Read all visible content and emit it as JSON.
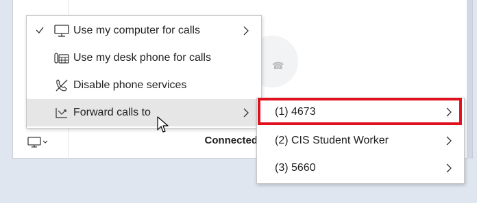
{
  "window": {
    "status_text": "Connected"
  },
  "menu": {
    "items": [
      {
        "label": "Use my computer for calls",
        "icon": "monitor-icon",
        "checked": true,
        "has_submenu": true
      },
      {
        "label": "Use my desk phone for calls",
        "icon": "desk-phone-icon",
        "checked": false,
        "has_submenu": false
      },
      {
        "label": "Disable phone services",
        "icon": "phone-off-icon",
        "checked": false,
        "has_submenu": false
      },
      {
        "label": "Forward calls to",
        "icon": "call-forward-icon",
        "checked": false,
        "has_submenu": true,
        "hovered": true
      }
    ]
  },
  "submenu": {
    "items": [
      {
        "label": "(1) 4673",
        "highlighted": true
      },
      {
        "label": "(2) CIS Student Worker",
        "highlighted": false
      },
      {
        "label": "(3) 5660",
        "highlighted": false
      }
    ]
  },
  "colors": {
    "highlight_border": "#e0101e",
    "hover_bg": "#e6e6e6",
    "page_bg": "#dfe6ef"
  }
}
